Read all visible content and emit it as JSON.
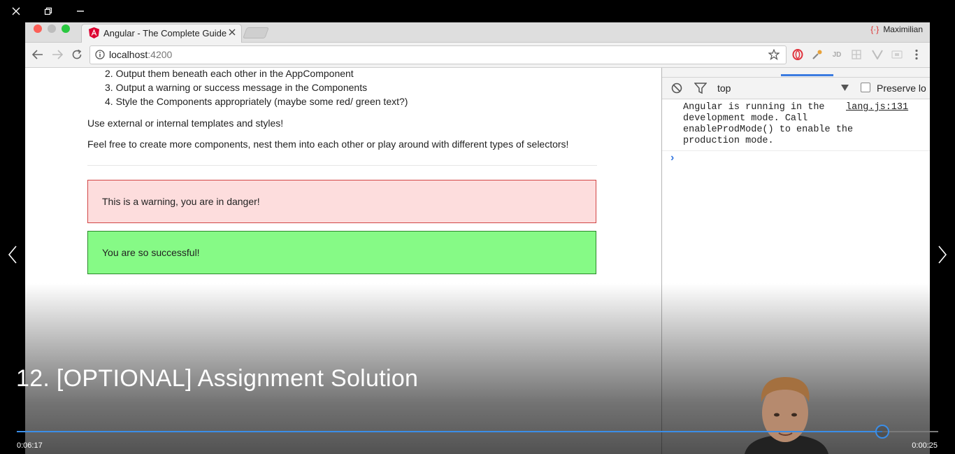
{
  "player": {
    "title": "12. [OPTIONAL] Assignment Solution",
    "elapsed": "0:06:17",
    "remaining": "0:00:25",
    "progress_percent": 93.9,
    "accent_color": "#3b8ee8"
  },
  "window_controls": [
    "close-icon",
    "restore-icon",
    "minimize-icon"
  ],
  "browser": {
    "tab_title": "Angular - The Complete Guide",
    "profile_name": "Maximilian",
    "url_host": "localhost",
    "url_port": ":4200"
  },
  "page": {
    "list": [
      "2. Output them beneath each other in the AppComponent",
      "3. Output a warning or success message in the Components",
      "4. Style the Components appropriately (maybe some red/ green text?)"
    ],
    "paragraphs": [
      "Use external or internal templates and styles!",
      "Feel free to create more components, nest them into each other or play around with different types of selectors!"
    ],
    "warning_text": "This is a warning, you are in danger!",
    "success_text": "You are so successful!",
    "warning_bg": "#fddddd",
    "warning_border": "#d24545",
    "success_bg": "#86fa86",
    "success_border": "#2a8a2a"
  },
  "devtools": {
    "context": "top",
    "preserve_log_label": "Preserve lo",
    "console_lines": [
      "Angular is running in the",
      "development mode. Call",
      "enableProdMode() to enable the",
      "production mode."
    ],
    "source_link": "lang.js:131",
    "prompt": "›"
  }
}
